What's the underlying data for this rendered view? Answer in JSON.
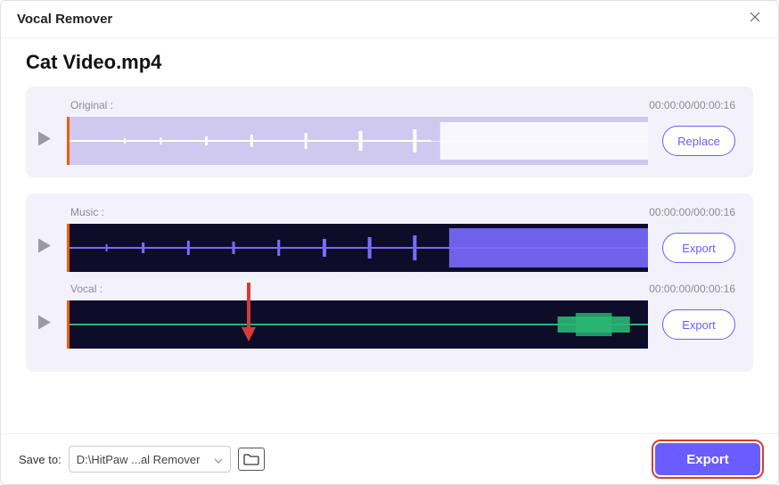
{
  "window": {
    "title": "Vocal Remover"
  },
  "file": {
    "name": "Cat Video.mp4"
  },
  "tracks": {
    "original": {
      "label": "Original :",
      "time": "00:00:00/00:00:16",
      "action": "Replace"
    },
    "music": {
      "label": "Music :",
      "time": "00:00:00/00:00:16",
      "action": "Export"
    },
    "vocal": {
      "label": "Vocal :",
      "time": "00:00:00/00:00:16",
      "action": "Export"
    }
  },
  "footer": {
    "save_label": "Save to:",
    "path": "D:\\HitPaw ...al Remover",
    "export_label": "Export"
  },
  "colors": {
    "accent": "#6a5cff",
    "annotation": "#d63b3b",
    "playhead": "#f25c05"
  }
}
